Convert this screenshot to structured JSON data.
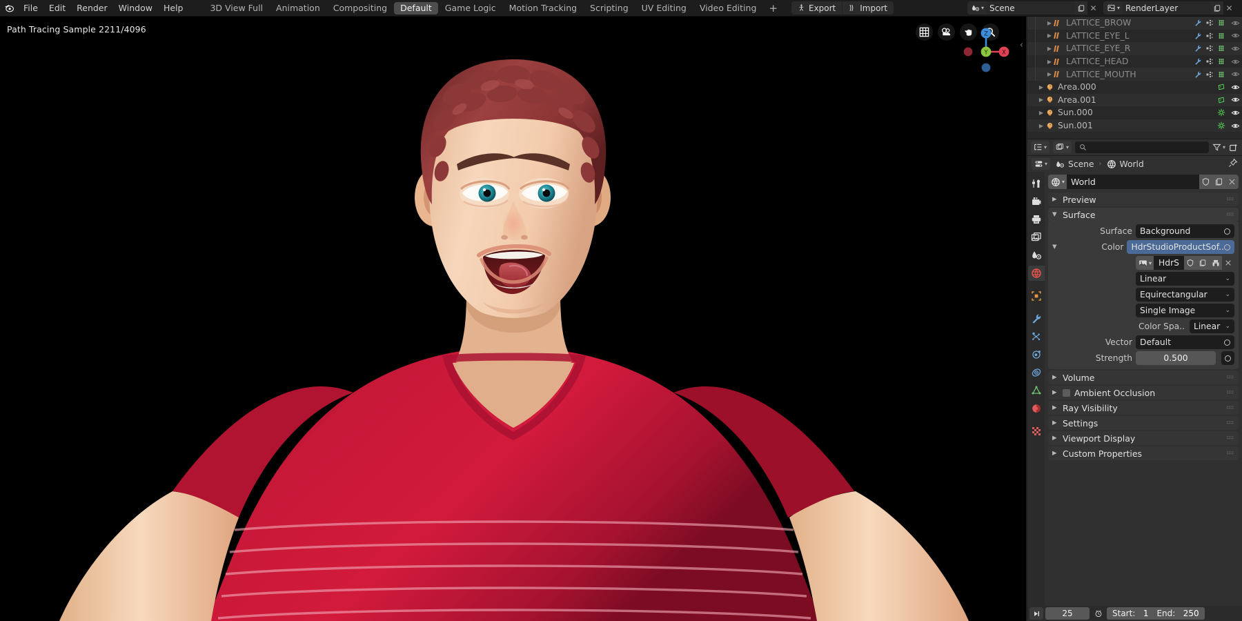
{
  "app": {
    "title": "Blender"
  },
  "topbar": {
    "menus": [
      "File",
      "Edit",
      "Render",
      "Window",
      "Help"
    ],
    "workspaces": [
      {
        "label": "3D View Full",
        "active": false
      },
      {
        "label": "Animation",
        "active": false
      },
      {
        "label": "Compositing",
        "active": false
      },
      {
        "label": "Default",
        "active": true
      },
      {
        "label": "Game Logic",
        "active": false
      },
      {
        "label": "Motion Tracking",
        "active": false
      },
      {
        "label": "Scripting",
        "active": false
      },
      {
        "label": "UV Editing",
        "active": false
      },
      {
        "label": "Video Editing",
        "active": false
      }
    ],
    "add_workspace": "+",
    "export_label": "Export",
    "import_label": "Import",
    "scene_name": "Scene",
    "viewlayer_name": "RenderLayer"
  },
  "viewport": {
    "stats": "Path Tracing Sample 2211/4096",
    "nav_icons": [
      "grid-icon",
      "camera-icon",
      "hand-icon",
      "zoom-icon"
    ],
    "gizmo_axes": [
      "Z",
      "Y",
      "X"
    ],
    "background": "#000000"
  },
  "outliner": {
    "rows": [
      {
        "label": "LATTICE_BROW",
        "depth": 3,
        "icon": "lattice-icon",
        "dim": true,
        "extras": [
          "wrench-icon",
          "modifier-icon",
          "lattice-data-icon"
        ],
        "visible": true
      },
      {
        "label": "LATTICE_EYE_L",
        "depth": 3,
        "icon": "lattice-icon",
        "dim": true,
        "extras": [
          "wrench-icon",
          "modifier-icon",
          "lattice-data-icon"
        ],
        "visible": true
      },
      {
        "label": "LATTICE_EYE_R",
        "depth": 3,
        "icon": "lattice-icon",
        "dim": true,
        "extras": [
          "wrench-icon",
          "modifier-icon",
          "lattice-data-icon"
        ],
        "visible": true
      },
      {
        "label": "LATTICE_HEAD",
        "depth": 3,
        "icon": "lattice-icon",
        "dim": true,
        "extras": [
          "wrench-icon",
          "modifier-icon",
          "lattice-data-icon"
        ],
        "visible": true
      },
      {
        "label": "LATTICE_MOUTH",
        "depth": 3,
        "icon": "lattice-icon",
        "dim": true,
        "extras": [
          "wrench-icon",
          "modifier-icon",
          "lattice-data-icon"
        ],
        "visible": true
      },
      {
        "label": "Area.000",
        "depth": 1,
        "icon": "light-icon",
        "dim": false,
        "extras": [
          "area-light-data-icon"
        ],
        "visible": true
      },
      {
        "label": "Area.001",
        "depth": 1,
        "icon": "light-icon",
        "dim": false,
        "extras": [
          "area-light-data-icon"
        ],
        "visible": true
      },
      {
        "label": "Sun.000",
        "depth": 1,
        "icon": "light-icon",
        "dim": false,
        "extras": [
          "sun-light-data-icon"
        ],
        "visible": true
      },
      {
        "label": "Sun.001",
        "depth": 1,
        "icon": "light-icon",
        "dim": false,
        "extras": [
          "sun-light-data-icon"
        ],
        "visible": true
      }
    ]
  },
  "properties_header": {
    "display_mode": "outliner-display-icon",
    "filter_type": "image-filter-icon",
    "search_placeholder": "",
    "search_value": "",
    "filter_icon": "funnel-icon",
    "new_collection_icon": "new-collection-icon"
  },
  "properties_breadcrumb": {
    "scene": "Scene",
    "world": "World",
    "pin_icon": "pin-icon"
  },
  "properties_tabs": [
    {
      "name": "tool",
      "icon": "tool-icon",
      "selected": false
    },
    {
      "name": "render",
      "icon": "render-icon",
      "selected": false
    },
    {
      "name": "output",
      "icon": "printer-icon",
      "selected": false
    },
    {
      "name": "view-layer",
      "icon": "images-icon",
      "selected": false
    },
    {
      "name": "scene",
      "icon": "scene-icon",
      "selected": false
    },
    {
      "name": "world",
      "icon": "world-icon",
      "selected": true
    },
    {
      "name": "object",
      "icon": "object-icon",
      "selected": false
    },
    {
      "name": "modifiers",
      "icon": "wrench-icon",
      "selected": false
    },
    {
      "name": "particles",
      "icon": "particles-icon",
      "selected": false
    },
    {
      "name": "physics",
      "icon": "physics-icon",
      "selected": false
    },
    {
      "name": "constraints",
      "icon": "constraint-icon",
      "selected": false
    },
    {
      "name": "object-data",
      "icon": "mesh-data-icon",
      "selected": false
    },
    {
      "name": "material",
      "icon": "material-icon",
      "selected": false
    },
    {
      "name": "texture",
      "icon": "texture-icon",
      "selected": false
    }
  ],
  "world": {
    "id_name": "World",
    "id_type_icon": "world-icon",
    "fake_user_icon": "shield-icon",
    "copy_icon": "copy-icon",
    "close_icon": "x-icon",
    "panels": [
      {
        "label": "Preview",
        "open": false,
        "checkbox": false
      },
      {
        "label": "Surface",
        "open": true,
        "checkbox": false
      }
    ],
    "surface": {
      "surface_label": "Surface",
      "surface_value": "Background",
      "color_label": "Color",
      "color_value": "HdrStudioProductSof..",
      "image_name": "HdrS",
      "interpolation": "Linear",
      "projection": "Equirectangular",
      "source": "Single Image",
      "colorspace_label": "Color Spa..",
      "colorspace_value": "Linear",
      "vector_label": "Vector",
      "vector_value": "Default",
      "strength_label": "Strength",
      "strength_value": "0.500"
    },
    "lower_panels": [
      {
        "label": "Volume",
        "open": false,
        "checkbox": false
      },
      {
        "label": "Ambient Occlusion",
        "open": false,
        "checkbox": true
      },
      {
        "label": "Ray Visibility",
        "open": false,
        "checkbox": false
      },
      {
        "label": "Settings",
        "open": false,
        "checkbox": false
      },
      {
        "label": "Viewport Display",
        "open": false,
        "checkbox": false
      },
      {
        "label": "Custom Properties",
        "open": false,
        "checkbox": false
      }
    ]
  },
  "timeline": {
    "play_icon": "jump-end-icon",
    "current_frame": "25",
    "clock_icon": "auto-key-icon",
    "start_label": "Start:",
    "start_value": "1",
    "end_label": "End:",
    "end_value": "250"
  },
  "colors": {
    "accent_blue": "#4b6a97",
    "shirt_red": "#c41638",
    "hair_red": "#8d3a3c",
    "skin": "#f2cdb0",
    "eye_teal": "#2a9aa5",
    "axis_x": "#e04356",
    "axis_y": "#8cc63f",
    "axis_z": "#3c8ddb"
  }
}
